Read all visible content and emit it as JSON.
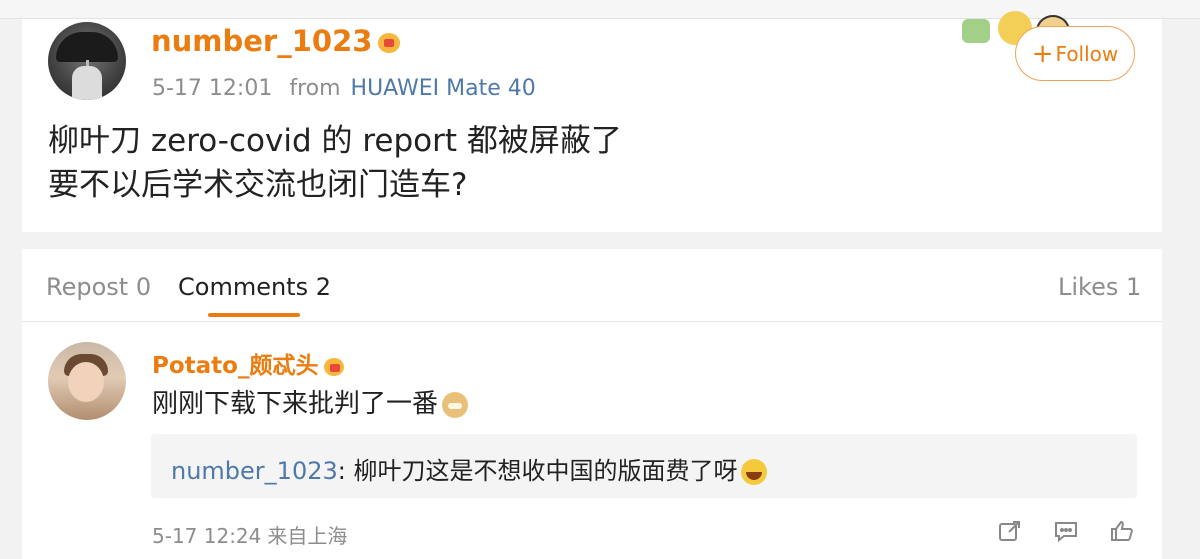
{
  "post": {
    "username": "number_1023",
    "time": "5-17 12:01",
    "from_label": "from",
    "device": "HUAWEI Mate 40",
    "follow_label": "Follow",
    "text": "柳叶刀 zero-covid 的 report 都被屏蔽了\n要不以后学术交流也闭门造车?"
  },
  "tabs": {
    "repost": "Repost 0",
    "comments": "Comments 2",
    "likes": "Likes 1"
  },
  "comment": {
    "username": "Potato_颇忒头",
    "text": "刚刚下载下来批判了一番",
    "reply": {
      "username": "number_1023",
      "separator": ":",
      "text": " 柳叶刀这是不想收中国的版面费了呀"
    },
    "time": "5-17 12:24",
    "location": "来自上海"
  },
  "icons": {
    "vip": "crown-badge-icon",
    "emoji_1": "doge-emoji-icon",
    "emoji_2": "laughing-emoji-icon",
    "share": "share-icon",
    "reply": "comment-icon",
    "like": "thumbs-up-icon"
  },
  "colors": {
    "username": "#eb7c10",
    "link": "#4f79aa",
    "accent": "#eb7c10"
  }
}
